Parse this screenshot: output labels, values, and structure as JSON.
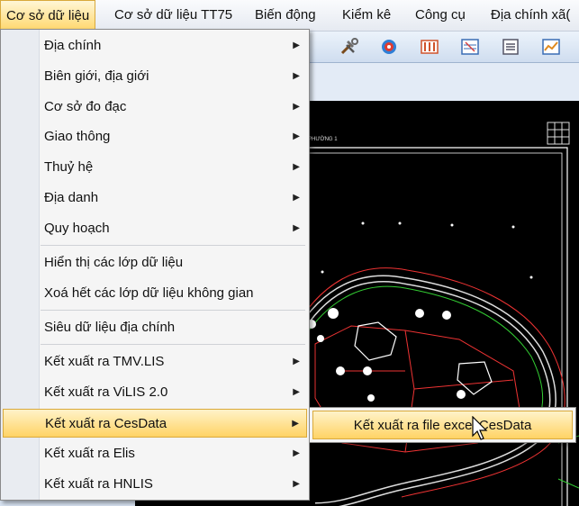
{
  "menubar": {
    "items": [
      "Cơ sở dữ liệu",
      "Cơ sở dữ liệu TT75",
      "Biến động",
      "Kiểm kê",
      "Công cụ",
      "Địa chính xã("
    ]
  },
  "toolbar": {
    "icons": [
      "tools-icon",
      "globe-target-icon",
      "columns-icon",
      "layers-icon",
      "document-icon",
      "chart-icon"
    ]
  },
  "menu": {
    "items": [
      {
        "label": "Địa chính",
        "submenu": true
      },
      {
        "label": "Biên giới, địa giới",
        "submenu": true
      },
      {
        "label": "Cơ sở đo đạc",
        "submenu": true
      },
      {
        "label": "Giao thông",
        "submenu": true
      },
      {
        "label": "Thuỷ hệ",
        "submenu": true
      },
      {
        "label": "Địa danh",
        "submenu": true
      },
      {
        "label": "Quy hoạch",
        "submenu": true
      },
      {
        "label": "Hiển thị các lớp dữ liệu",
        "submenu": false
      },
      {
        "label": "Xoá hết các lớp dữ liệu không gian",
        "submenu": false
      },
      {
        "label": "Siêu dữ liệu địa chính",
        "submenu": false
      },
      {
        "label": "Kết xuất ra TMV.LIS",
        "submenu": true
      },
      {
        "label": "Kết xuất ra ViLIS 2.0",
        "submenu": true
      },
      {
        "label": "Kết xuất ra CesData",
        "submenu": true
      },
      {
        "label": "Kết xuất ra Elis",
        "submenu": true
      },
      {
        "label": "Kết xuất ra HNLIS",
        "submenu": true
      }
    ],
    "arrow": "▶"
  },
  "submenu": {
    "item": "Kết xuất ra file excel CesData"
  },
  "canvas": {
    "map_title": "PHƯỜNG 1"
  },
  "colors": {
    "menu_highlight": "#ffd365",
    "menu_bg": "#f5f5f5",
    "canvas_bg": "#000000",
    "toolbar_bg": "#cfddef"
  }
}
